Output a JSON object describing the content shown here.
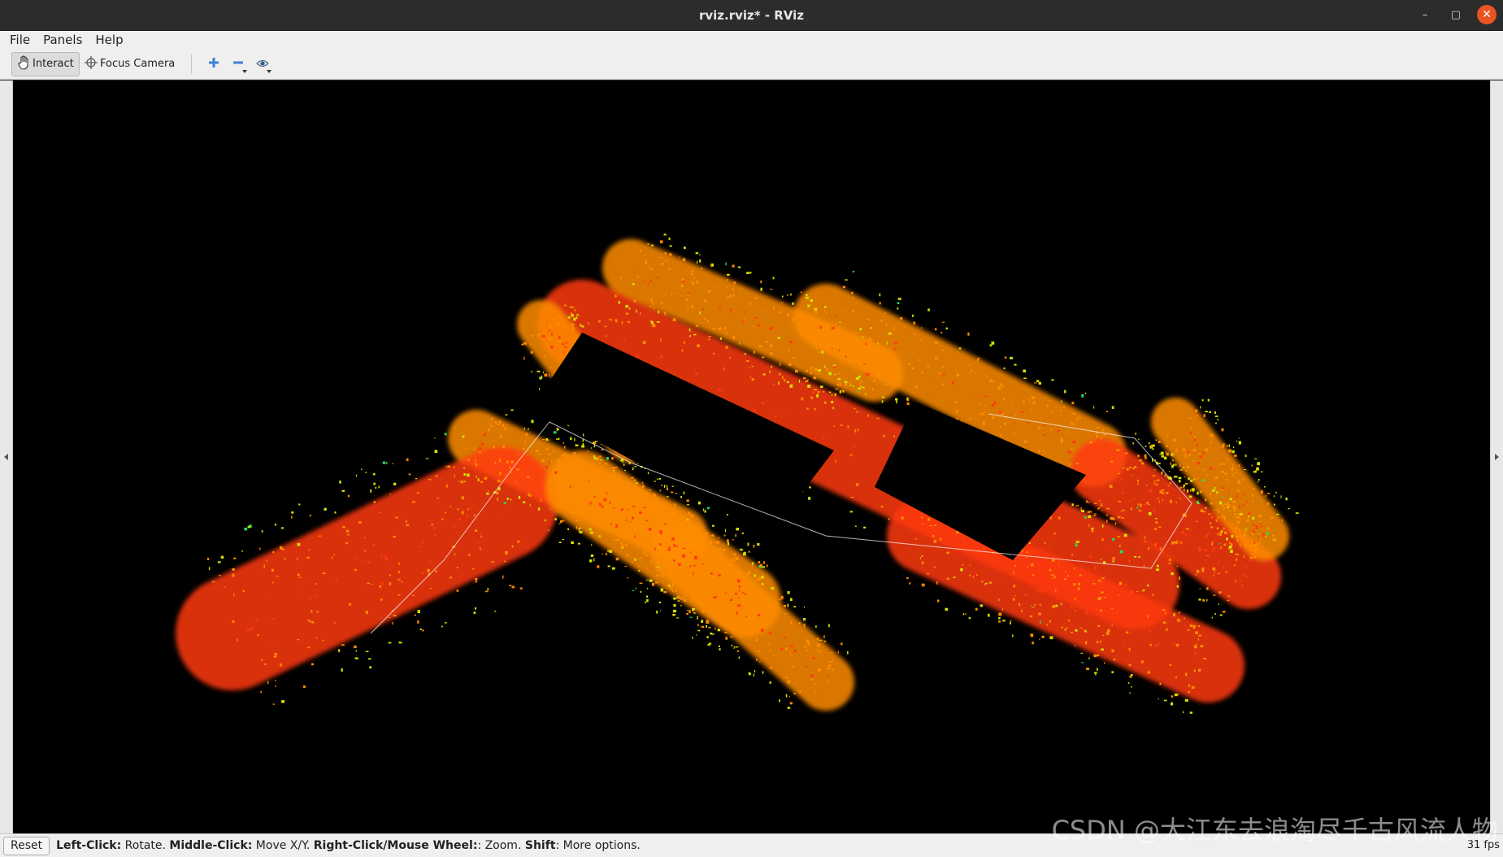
{
  "window": {
    "title": "rviz.rviz* - RViz",
    "minimize_glyph": "–",
    "maximize_glyph": "▢",
    "close_glyph": "✕"
  },
  "menu": {
    "file": "File",
    "panels": "Panels",
    "help": "Help"
  },
  "toolbar": {
    "interact_label": "Interact",
    "focus_camera_label": "Focus Camera",
    "icons": [
      "hand-icon",
      "crosshair-icon",
      "plus-icon",
      "minus-icon",
      "eye-icon"
    ]
  },
  "viewport": {
    "description_icon": "point-cloud-map",
    "background": "#000000"
  },
  "status": {
    "reset_label": "Reset",
    "left_click_key": "Left-Click:",
    "left_click_action": " Rotate. ",
    "middle_click_key": "Middle-Click:",
    "middle_click_action": " Move X/Y. ",
    "right_click_key": "Right-Click/Mouse Wheel:",
    "right_click_action": ": Zoom. ",
    "shift_key": "Shift",
    "shift_action": ": More options.",
    "fps": "31 fps"
  },
  "watermark": "CSDN @大江东去浪淘尽千古风流人物",
  "colors": {
    "accent_close": "#e95420",
    "cloud_hot": "#ff3a10",
    "cloud_warm": "#ff8c00",
    "cloud_mid": "#d8e000",
    "cloud_cool": "#20e060",
    "cloud_cold": "#2090ff"
  }
}
